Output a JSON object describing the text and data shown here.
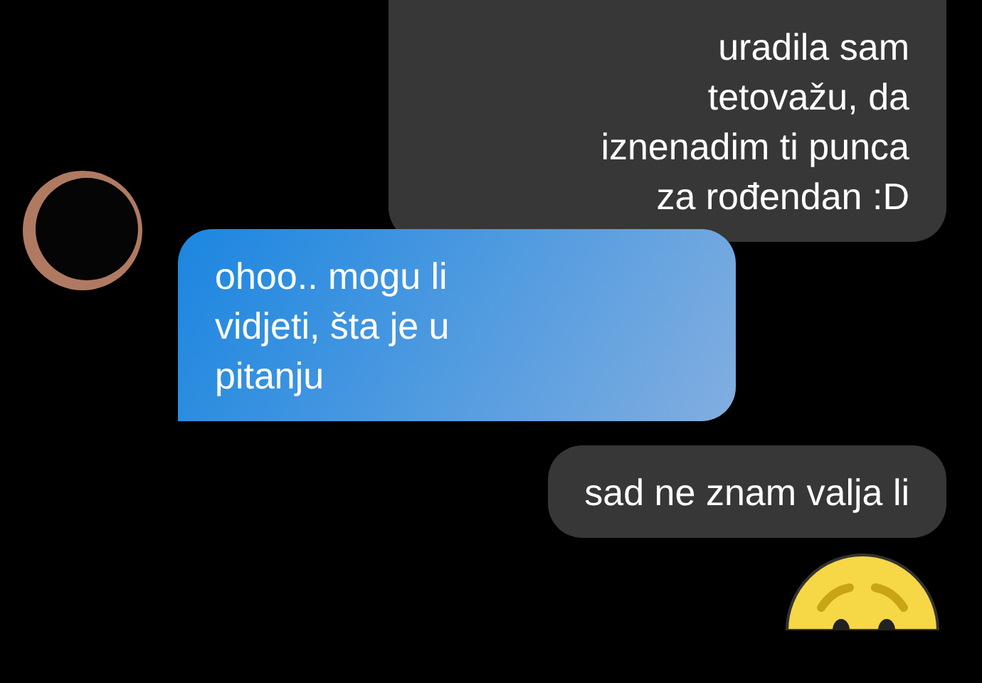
{
  "messages": [
    {
      "outgoing": true,
      "kind": "text",
      "text": "uradila sam\ntetovažu, da\niznenadim ti punca\nza rođendan :D"
    },
    {
      "outgoing": false,
      "kind": "text",
      "text": "ohoo.. mogu li\nvidjeti, šta je u\npitanju"
    },
    {
      "outgoing": true,
      "kind": "text",
      "text": "sad ne znam valja li"
    },
    {
      "outgoing": true,
      "kind": "emoji"
    }
  ]
}
